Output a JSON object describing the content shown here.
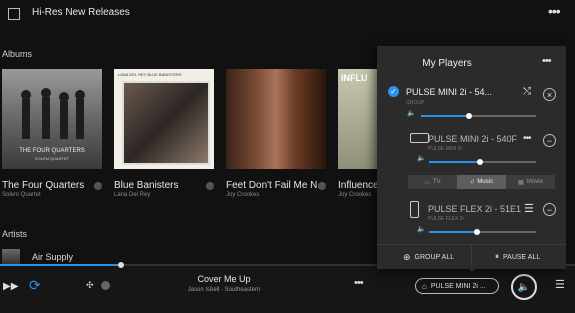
{
  "header": {
    "title": "Hi-Res New Releases"
  },
  "sections": {
    "albums": "Albums",
    "artists": "Artists"
  },
  "albums": [
    {
      "title": "The Four Quarters",
      "artist": "Solem Quartet",
      "art_text": "THE FOUR QUARTERS",
      "art_sub": "SOLEM QUARTET"
    },
    {
      "title": "Blue Banisters",
      "artist": "Lana Del Rey",
      "art_text": "LANA DEL REY    BLUE BANISTERS"
    },
    {
      "title": "Feet Don't Fail Me N...",
      "artist": "Joy Crookes"
    },
    {
      "title": "Influence E",
      "artist": "Joy Crookes",
      "art_text": "INFLU"
    }
  ],
  "artists": [
    {
      "name": "Air Supply"
    }
  ],
  "now_playing": {
    "title": "Cover Me Up",
    "subtitle": "Jason Isbell · Southeastern",
    "progress": 0.21
  },
  "player_pill": {
    "label": "PULSE MINI 2i ..."
  },
  "players_panel": {
    "title": "My Players",
    "players": [
      {
        "name": "PULSE MINI 2i - 54...",
        "sub": "GROUP",
        "volume": 0.42,
        "selected": true
      },
      {
        "name": "PULSE MINI 2i - 540F",
        "sub": "PULSE MINI 2i",
        "volume": 0.48
      },
      {
        "name": "PULSE FLEX 2i - 51E1",
        "sub": "PULSE FLEX 2i",
        "volume": 0.45
      }
    ],
    "modes": [
      {
        "label": "TV"
      },
      {
        "label": "Music",
        "active": true
      },
      {
        "label": "Movie"
      }
    ],
    "group_all": "GROUP ALL",
    "pause_all": "PAUSE ALL"
  },
  "colors": {
    "accent": "#2d8ff0",
    "panel": "#2b2b2b",
    "background": "#111111"
  }
}
